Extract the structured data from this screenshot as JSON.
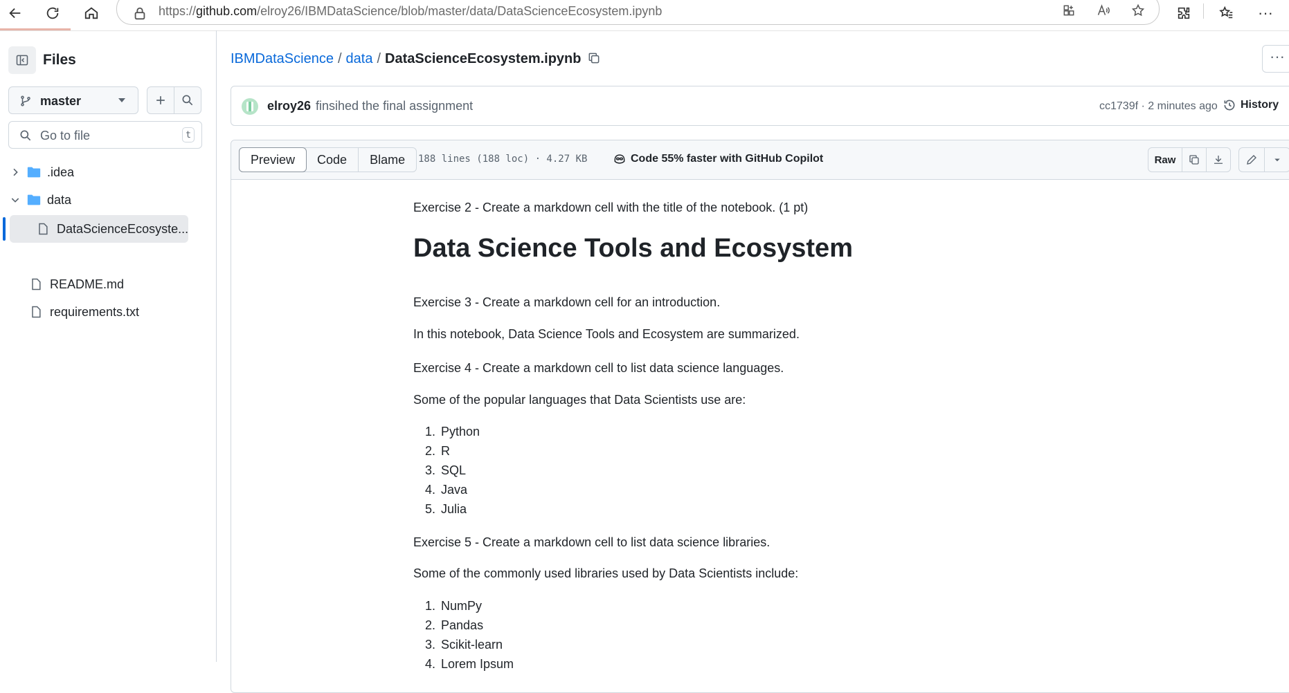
{
  "browser": {
    "url_prefix": "https://",
    "url_host": "github.com",
    "url_path": "/elroy26/IBMDataScience/blob/master/data/DataScienceEcosystem.ipynb"
  },
  "sidebar": {
    "title": "Files",
    "branch": "master",
    "goto_placeholder": "Go to file",
    "goto_shortcut": "t",
    "tree": [
      {
        "label": ".idea",
        "type": "folder",
        "expanded": false
      },
      {
        "label": "data",
        "type": "folder",
        "expanded": true
      },
      {
        "label": "DataScienceEcosyste...",
        "type": "file",
        "active": true
      },
      {
        "label": "README.md",
        "type": "file"
      },
      {
        "label": "requirements.txt",
        "type": "file"
      }
    ]
  },
  "breadcrumb": {
    "repo": "IBMDataScience",
    "folder": "data",
    "file": "DataScienceEcosystem.ipynb"
  },
  "commit": {
    "author": "elroy26",
    "message": "finsihed the final assignment",
    "sha_time": "cc1739f · 2 minutes ago",
    "history_label": "History"
  },
  "file_header": {
    "tabs": [
      "Preview",
      "Code",
      "Blame"
    ],
    "active_tab": "Preview",
    "info": "188 lines (188 loc) · 4.27 KB",
    "copilot": "Code 55% faster with GitHub Copilot",
    "raw_label": "Raw"
  },
  "notebook": {
    "ex2": "Exercise 2 - Create a markdown cell with the title of the notebook. (1 pt)",
    "title": "Data Science Tools and Ecosystem",
    "ex3": "Exercise 3 - Create a markdown cell for an introduction.",
    "intro": "In this notebook, Data Science Tools and Ecosystem are summarized.",
    "ex4": "Exercise 4 - Create a markdown cell to list data science languages.",
    "lang_intro": "Some of the popular languages that Data Scientists use are:",
    "languages": [
      "Python",
      "R",
      "SQL",
      "Java",
      "Julia"
    ],
    "ex5": "Exercise 5 - Create a markdown cell to list data science libraries.",
    "lib_intro": "Some of the commonly used libraries used by Data Scientists include:",
    "libraries": [
      "NumPy",
      "Pandas",
      "Scikit-learn",
      "Lorem Ipsum"
    ]
  }
}
